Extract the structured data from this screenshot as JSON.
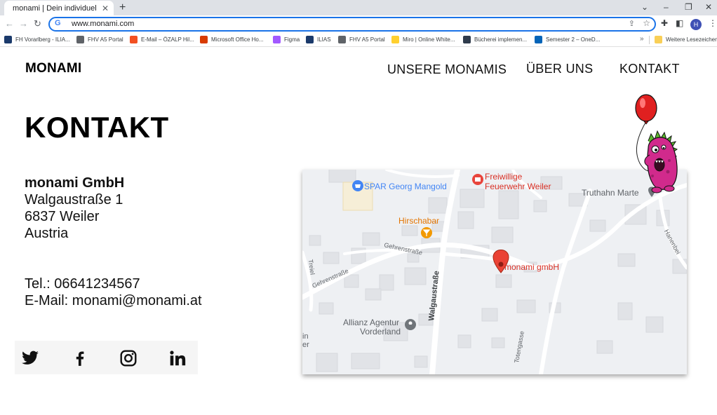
{
  "browser": {
    "tab_title": "monami | Dein individuel",
    "tab_close": "✕",
    "new_tab": "+",
    "url": "www.monami.com",
    "profile_initial": "H",
    "bookmarks": [
      {
        "label": "FH Vorarlberg - ILIA...",
        "color": "#1b3a6b"
      },
      {
        "label": "FHV A5 Portal",
        "color": "#5f6368"
      },
      {
        "label": "E-Mail – ÖZALP Hil...",
        "color": "#f25022"
      },
      {
        "label": "Microsoft Office Ho...",
        "color": "#d83b01"
      },
      {
        "label": "Figma",
        "color": "#a259ff"
      },
      {
        "label": "ILIAS",
        "color": "#1b3a6b"
      },
      {
        "label": "FHV A5 Portal",
        "color": "#5f6368"
      },
      {
        "label": "Miro | Online White...",
        "color": "#ffd02f"
      },
      {
        "label": "Bücherei implemen...",
        "color": "#2f3b4c"
      },
      {
        "label": "Semester 2 – OneD...",
        "color": "#0364b8"
      }
    ],
    "bookmarks_more": "»",
    "other_bookmarks": "Weitere Lesezeichen"
  },
  "site": {
    "logo": "MONAMI",
    "nav": {
      "monamis": "UNSERE MONAMIS",
      "about": "ÜBER UNS",
      "contact": "KONTAKT"
    },
    "page_title": "KONTAKT",
    "address": {
      "company": "monami GmbH",
      "street": "Walgaustraße 1",
      "city": "6837 Weiler",
      "country": "Austria"
    },
    "contact": {
      "phone": "Tel.: 06641234567",
      "email": "E-Mail: monami@monami.at"
    },
    "social": [
      "twitter",
      "facebook",
      "instagram",
      "linkedin"
    ]
  },
  "map": {
    "labels": {
      "spar": "SPAR Georg Mangold",
      "feuerwehr_1": "Freiwillige",
      "feuerwehr_2": "Feuerwehr Weiler",
      "truthahn": "Truthahn Marte",
      "hirschabar": "Hirschabar",
      "gehrenstrasse_1": "Gehrenstraße",
      "gehrenstrasse_2": "Gehrenstraße",
      "treiel": "Treiel",
      "walgaustrasse": "Walgaustraße",
      "marker": "monami gmbH",
      "allianz_1": "Allianz Agentur",
      "allianz_2": "Vorderland",
      "totengasse": "Totengasse",
      "hanenbei": "Hanenbei",
      "edge_1": "in",
      "edge_2": "er"
    },
    "colors": {
      "poi_red": "#d93025",
      "poi_orange": "#e37400",
      "poi_blue": "#4285f4",
      "poi_grey": "#70757a"
    }
  }
}
